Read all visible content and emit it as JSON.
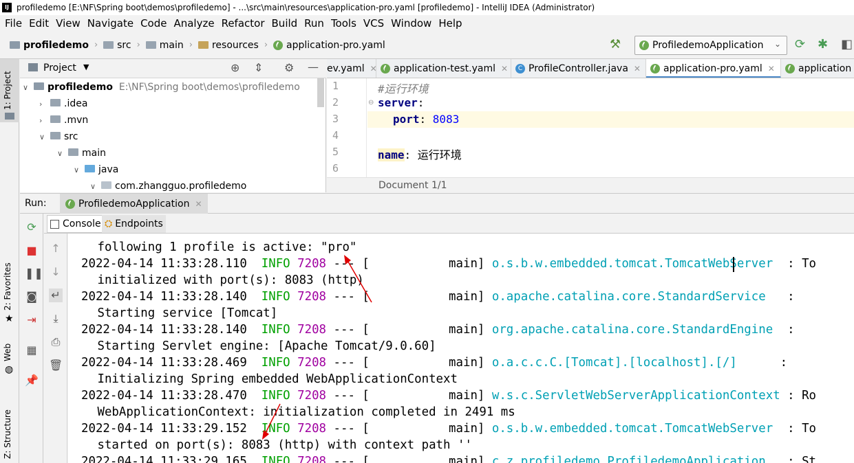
{
  "window": {
    "title": "profiledemo [E:\\NF\\Spring boot\\demos\\profiledemo] - ...\\src\\main\\resources\\application-pro.yaml [profiledemo] - IntelliJ IDEA (Administrator)"
  },
  "menu": [
    "File",
    "Edit",
    "View",
    "Navigate",
    "Code",
    "Analyze",
    "Refactor",
    "Build",
    "Run",
    "Tools",
    "VCS",
    "Window",
    "Help"
  ],
  "breadcrumb": [
    "profiledemo",
    "src",
    "main",
    "resources",
    "application-pro.yaml"
  ],
  "run_config": {
    "label": "ProfiledemoApplication"
  },
  "left_strip": {
    "project": "1: Project",
    "favorites": "2: Favorites",
    "web": "Web",
    "structure": "Z: Structure"
  },
  "project_panel": {
    "title": "Project",
    "tree": [
      {
        "label": "profiledemo",
        "path": "E:\\NF\\Spring boot\\demos\\profiledemo"
      },
      {
        "label": ".idea"
      },
      {
        "label": ".mvn"
      },
      {
        "label": "src"
      },
      {
        "label": "main"
      },
      {
        "label": "java"
      },
      {
        "label": "com.zhangguo.profiledemo"
      }
    ]
  },
  "editor": {
    "tabs": [
      "ev.yaml",
      "application-test.yaml",
      "ProfileController.java",
      "application-pro.yaml",
      "application"
    ],
    "line_numbers": [
      "1",
      "2",
      "3",
      "4",
      "5",
      "6"
    ],
    "lines": {
      "comment": "#运行环境",
      "server_key": "server",
      "port_key": "port",
      "port_value": "8083",
      "name_key": "name",
      "name_value": "运行环境"
    },
    "status": "Document 1/1"
  },
  "run_panel": {
    "label": "Run:",
    "tab": "ProfiledemoApplication",
    "console_tab": "Console",
    "endpoints_tab": "Endpoints"
  },
  "console": {
    "lines": [
      {
        "kind": "cont",
        "text": " following 1 profile is active: \"pro\""
      },
      {
        "kind": "log",
        "ts": "2022-04-14 11:33:28.110",
        "level": "INFO",
        "pid": "7208",
        "sep": " --- [",
        "thread": "           main]",
        "logger": " o.s.b.w.embedded.tomcat.TomcatWebServer",
        "tail": "  : To"
      },
      {
        "kind": "cont",
        "text": " initialized with port(s): 8083 (http)"
      },
      {
        "kind": "log",
        "ts": "2022-04-14 11:33:28.140",
        "level": "INFO",
        "pid": "7208",
        "sep": " --- [",
        "thread": "           main]",
        "logger": " o.apache.catalina.core.StandardService",
        "tail": "   :"
      },
      {
        "kind": "cont",
        "text": " Starting service [Tomcat]"
      },
      {
        "kind": "log",
        "ts": "2022-04-14 11:33:28.140",
        "level": "INFO",
        "pid": "7208",
        "sep": " --- [",
        "thread": "           main]",
        "logger": " org.apache.catalina.core.StandardEngine",
        "tail": "  :"
      },
      {
        "kind": "cont",
        "text": " Starting Servlet engine: [Apache Tomcat/9.0.60]"
      },
      {
        "kind": "log",
        "ts": "2022-04-14 11:33:28.469",
        "level": "INFO",
        "pid": "7208",
        "sep": " --- [",
        "thread": "           main]",
        "logger": " o.a.c.c.C.[Tomcat].[localhost].[/]",
        "tail": "      :"
      },
      {
        "kind": "cont",
        "text": " Initializing Spring embedded WebApplicationContext"
      },
      {
        "kind": "log",
        "ts": "2022-04-14 11:33:28.470",
        "level": "INFO",
        "pid": "7208",
        "sep": " --- [",
        "thread": "           main]",
        "logger": " w.s.c.ServletWebServerApplicationContext",
        "tail": " : Ro"
      },
      {
        "kind": "cont",
        "text": " WebApplicationContext: initialization completed in 2491 ms"
      },
      {
        "kind": "log",
        "ts": "2022-04-14 11:33:29.152",
        "level": "INFO",
        "pid": "7208",
        "sep": " --- [",
        "thread": "           main]",
        "logger": " o.s.b.w.embedded.tomcat.TomcatWebServer",
        "tail": "  : To"
      },
      {
        "kind": "cont",
        "text": " started on port(s): 8083 (http) with context path ''"
      },
      {
        "kind": "log",
        "ts": "2022-04-14 11:33:29.165",
        "level": "INFO",
        "pid": "7208",
        "sep": " --- [",
        "thread": "           main]",
        "logger": " c.z.profiledemo.ProfiledemoApplication",
        "tail": "   : St"
      }
    ]
  },
  "colors": {
    "info": "#00a000",
    "pid": "#a000a0",
    "logger": "#00a0b4",
    "annotation": "#e00000",
    "keyword": "#000080",
    "number": "#0000ff"
  }
}
